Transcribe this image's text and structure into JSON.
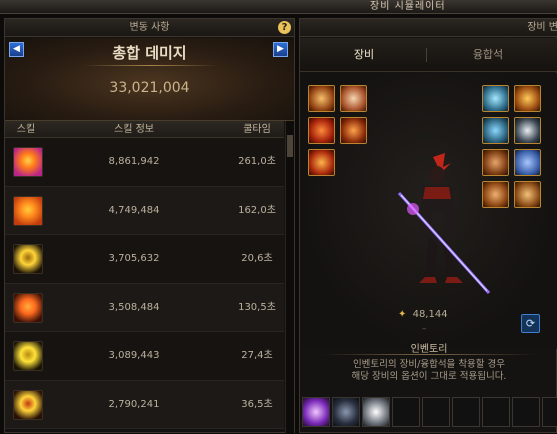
{
  "window": {
    "title": "장비 시뮬레이터"
  },
  "left_panel": {
    "header": "변동 사항",
    "help_icon": "?",
    "prev_icon": "◀",
    "next_icon": "▶",
    "damage_label": "총합 데미지",
    "damage_value": "33,021,004",
    "columns": {
      "skill": "스킬",
      "info": "스킬 정보",
      "cooldown": "쿨타임"
    },
    "rows": [
      {
        "icon": "skill-icon-flare",
        "value": "8,861,942",
        "cooldown": "261,0초",
        "colors": [
          "#ff7a1a",
          "#ffd24a",
          "#b8248a"
        ]
      },
      {
        "icon": "skill-icon-slash",
        "value": "4,749,484",
        "cooldown": "162,0초",
        "colors": [
          "#ff8a1f",
          "#ffcf3a",
          "#c13b0c"
        ]
      },
      {
        "icon": "skill-icon-ring",
        "value": "3,705,632",
        "cooldown": "20,6초",
        "colors": [
          "#ffd43a",
          "#9a6a08",
          "#1a1205"
        ]
      },
      {
        "icon": "skill-icon-burst",
        "value": "3,508,484",
        "cooldown": "130,5초",
        "colors": [
          "#ff6a1f",
          "#ffae3a",
          "#3b1006"
        ]
      },
      {
        "icon": "skill-icon-orbit",
        "value": "3,089,443",
        "cooldown": "27,4초",
        "colors": [
          "#ffe23a",
          "#b88b10",
          "#1a1405"
        ]
      },
      {
        "icon": "skill-icon-star",
        "value": "2,790,241",
        "cooldown": "36,5초",
        "colors": [
          "#ffd43a",
          "#c23a10",
          "#281005"
        ]
      }
    ]
  },
  "right_panel": {
    "header": "장비 변",
    "tabs": {
      "equipment": "장비",
      "fusion": "융합석"
    },
    "power_value": "48,144",
    "power_dash": "–",
    "refresh_icon": "⟳",
    "inventory_title": "인벤토리",
    "inventory_desc_1": "인벤토리의 장비/융합석을 착용할 경우",
    "inventory_desc_2": "해당 장비의 옵션이 그대로 적용됩니다."
  },
  "colors": {
    "accent": "#d9a54a",
    "blue_button": "#2d6fd6"
  }
}
